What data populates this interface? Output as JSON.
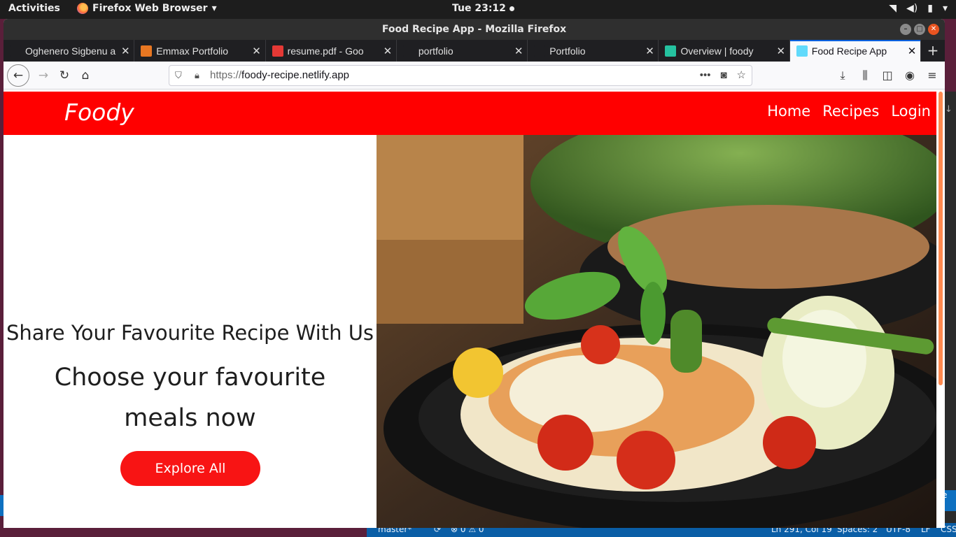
{
  "system": {
    "activities": "Activities",
    "app_menu": "Firefox Web Browser",
    "clock": "Tue 23:12"
  },
  "window": {
    "title": "Food Recipe App - Mozilla Firefox"
  },
  "tabs": [
    {
      "label": "Oghenero Sigbenu a",
      "favicon_color": "#1f1f22"
    },
    {
      "label": "Emmax Portfolio",
      "favicon_color": "#e87722"
    },
    {
      "label": "resume.pdf - Goo",
      "favicon_color": "#e53935"
    },
    {
      "label": "portfolio",
      "favicon_color": "#1f1f22"
    },
    {
      "label": "Portfolio",
      "favicon_color": "#1f1f22"
    },
    {
      "label": "Overview | foody",
      "favicon_color": "#25c2a0"
    },
    {
      "label": "Food Recipe App",
      "favicon_color": "#61dafb",
      "active": true
    }
  ],
  "urlbar": {
    "protocol": "https://",
    "host": "foody-recipe.netlify.app"
  },
  "site": {
    "logo": "Foody",
    "nav": [
      "Home",
      "Recipes",
      "Login"
    ],
    "hero": {
      "tagline": "Share Your Favourite Recipe With Us",
      "headline": "Choose your favourite meals now",
      "cta": "Explore All"
    },
    "accent_color": "#ff0000"
  },
  "editor_status": {
    "branch": "master*",
    "problems": "⊗ 0 ⚠ 0",
    "position": "Ln 291, Col 19",
    "spaces": "Spaces: 2",
    "encoding": "UTF-8",
    "eol": "LF",
    "language": "CSS"
  }
}
